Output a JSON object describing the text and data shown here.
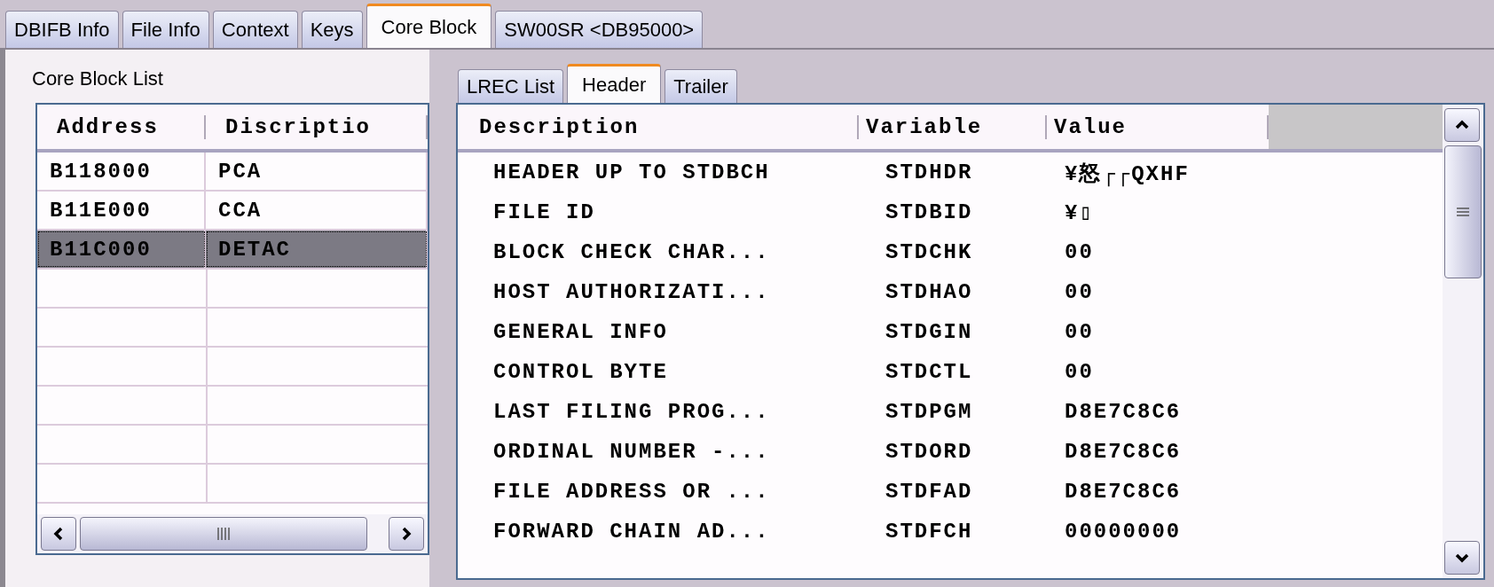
{
  "tabs": [
    {
      "label": "DBIFB Info",
      "selected": false
    },
    {
      "label": "File Info",
      "selected": false
    },
    {
      "label": "Context",
      "selected": false
    },
    {
      "label": "Keys",
      "selected": false
    },
    {
      "label": "Core Block",
      "selected": true
    },
    {
      "label": "SW00SR <DB95000>",
      "selected": false
    }
  ],
  "core_block_list": {
    "title": "Core Block List",
    "columns": [
      "Address",
      "Discriptio"
    ],
    "rows": [
      {
        "cells": [
          "B118000",
          "PCA"
        ],
        "selected": false
      },
      {
        "cells": [
          "B11E000",
          "CCA"
        ],
        "selected": false
      },
      {
        "cells": [
          "B11C000",
          "DETAC"
        ],
        "selected": true
      }
    ]
  },
  "subtabs": [
    {
      "label": "LREC List",
      "selected": false
    },
    {
      "label": "Header",
      "selected": true
    },
    {
      "label": "Trailer",
      "selected": false
    }
  ],
  "header_table": {
    "columns": [
      "Description",
      "Variable",
      "Value"
    ],
    "rows": [
      [
        "HEADER UP TO STDBCH",
        "STDHDR",
        "¥怒┌┌QXHF"
      ],
      [
        "FILE ID",
        "STDBID",
        "¥▯"
      ],
      [
        "BLOCK CHECK CHAR...",
        "STDCHK",
        "00"
      ],
      [
        "HOST AUTHORIZATI...",
        "STDHAO",
        "00"
      ],
      [
        "GENERAL INFO",
        "STDGIN",
        "00"
      ],
      [
        "CONTROL BYTE",
        "STDCTL",
        "00"
      ],
      [
        "LAST FILING PROG...",
        "STDPGM",
        "D8E7C8C6"
      ],
      [
        "ORDINAL NUMBER -...",
        "STDORD",
        "D8E7C8C6"
      ],
      [
        "FILE ADDRESS OR ...",
        "STDFAD",
        "D8E7C8C6"
      ],
      [
        "FORWARD CHAIN AD...",
        "STDFCH",
        "00000000"
      ]
    ]
  }
}
